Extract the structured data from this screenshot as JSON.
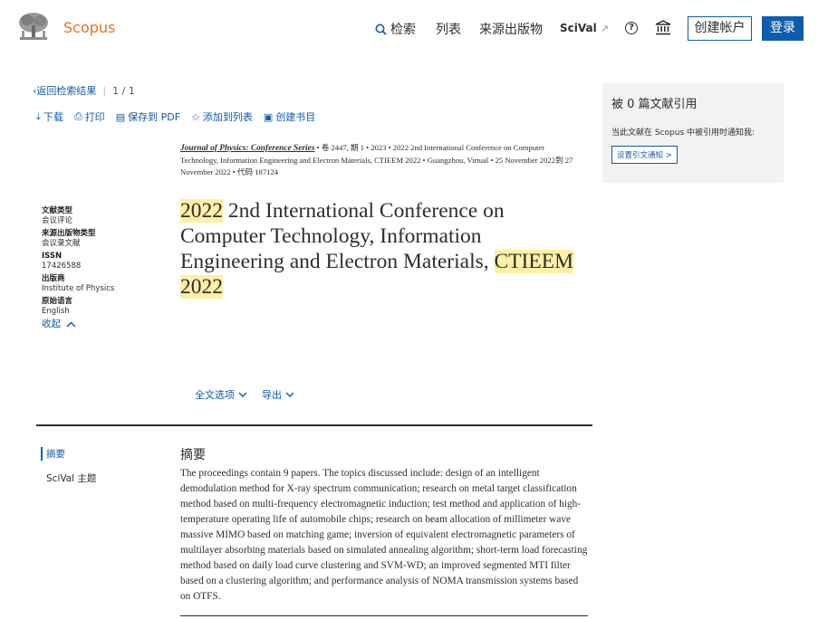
{
  "header": {
    "logo_text": "Scopus",
    "nav": {
      "search": "检索",
      "lists": "列表",
      "sources": "来源出版物",
      "scival": "SciVal",
      "scival_ext": "↗"
    },
    "help_symbol": "?",
    "create_account": "创建帐户",
    "login": "登录"
  },
  "breadcrumb": {
    "back": "返回检索结果",
    "pager": "1 / 1"
  },
  "actions": {
    "download": "下载",
    "print": "打印",
    "save_pdf": "保存到 PDF",
    "add_list": "添加到列表",
    "create_bib": "创建书目"
  },
  "citation": {
    "journal": "Journal of Physics: Conference Series",
    "rest": " • 卷 2447, 期 1 • 2023 • 2022 2nd International Conference on Computer Technology, Information Engineering and Electron Materials, CTIEEM 2022 • Guangzhou, Virtual • 25 November 2022到 27 November 2022 • 代码 187124"
  },
  "metadata": {
    "doc_type_label": "文献类型",
    "doc_type": "会议评论",
    "source_type_label": "来源出版物类型",
    "source_type": "会议录文献",
    "issn_label": "ISSN",
    "issn": "17426588",
    "publisher_label": "出版商",
    "publisher": "Institute of Physics",
    "language_label": "原始语言",
    "language": "English",
    "collapse": "收起"
  },
  "title": {
    "p1": "2022",
    "p2": " 2nd International Conference on Computer Technology, Information Engineering and Electron Materials, ",
    "p3": "CTIEEM",
    "p4": "2022"
  },
  "fulltext": {
    "options": "全文选项",
    "export": "导出"
  },
  "section_nav": {
    "abstract": "摘要",
    "scival_topics": "SciVal 主题"
  },
  "abstract": {
    "heading": "摘要",
    "text": "The proceedings contain 9 papers. The topics discussed include: design of an intelligent demodulation method for X-ray spectrum communication; research on metal target classification method based on multi-frequency electromagnetic induction; test method and application of high-temperature operating life of automobile chips; research on beam allocation of millimeter wave massive MIMO based on matching game; inversion of equivalent electromagnetic parameters of multilayer absorbing materials based on simulated annealing algorithm; short-term load forecasting method based on daily load curve clustering and SVM-WD; an improved segmented MTI filter based on a clustering algorithm; and performance analysis of NOMA transmission systems based on OTFS."
  },
  "cited_panel": {
    "title": "被 0 篇文献引用",
    "notify_text": "当此文献在 Scopus 中被引用时通知我:",
    "button": "设置引文通知 >"
  },
  "colors": {
    "accent": "#0e5cad",
    "brand": "#e9711c",
    "highlight": "#fff0a6"
  }
}
